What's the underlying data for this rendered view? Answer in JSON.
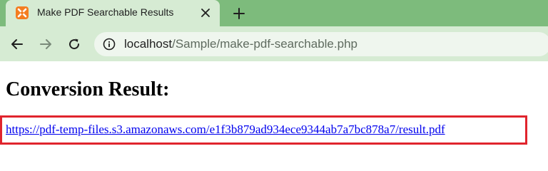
{
  "browser": {
    "tab": {
      "title": "Make PDF Searchable Results"
    },
    "address_bar": {
      "host": "localhost",
      "path": "/Sample/make-pdf-searchable.php"
    },
    "icons": {
      "favicon": "xampp-icon",
      "close": "close-icon",
      "new_tab": "plus-icon",
      "back": "back-arrow-icon",
      "forward": "forward-arrow-icon",
      "reload": "reload-icon",
      "site_info": "info-icon"
    },
    "colors": {
      "tab_strip": "#7dbb7c",
      "toolbar": "#d6ebd3",
      "omnibox": "#eff6ee"
    }
  },
  "page": {
    "heading": "Conversion Result:",
    "result_link": "https://pdf-temp-files.s3.amazonaws.com/e1f3b879ad934ece9344ab7a7bc878a7/result.pdf",
    "highlight_color": "#e0242d",
    "link_color": "#0000ee"
  }
}
